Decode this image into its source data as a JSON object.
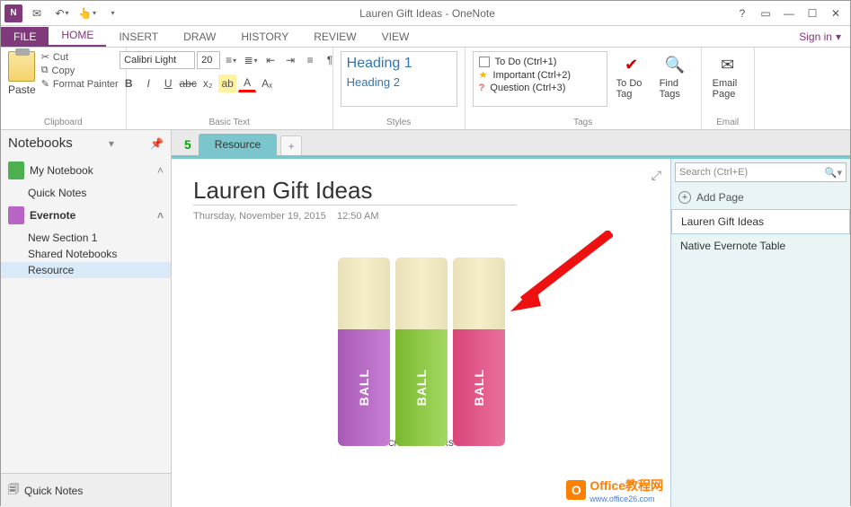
{
  "window": {
    "title": "Lauren Gift Ideas - OneNote"
  },
  "tabs": {
    "file": "FILE",
    "home": "HOME",
    "insert": "INSERT",
    "draw": "DRAW",
    "history": "HISTORY",
    "review": "REVIEW",
    "view": "VIEW",
    "signin": "Sign in"
  },
  "clipboard": {
    "label": "Clipboard",
    "paste": "Paste",
    "cut": "Cut",
    "copy": "Copy",
    "painter": "Format Painter"
  },
  "font": {
    "label": "Basic Text",
    "name": "Calibri Light",
    "size": "20"
  },
  "styles": {
    "label": "Styles",
    "h1": "Heading 1",
    "h2": "Heading 2"
  },
  "tags": {
    "label": "Tags",
    "todo": "To Do (Ctrl+1)",
    "important": "Important (Ctrl+2)",
    "question": "Question (Ctrl+3)",
    "todotag": "To Do Tag",
    "findtags": "Find Tags"
  },
  "email": {
    "label": "Email",
    "button": "Email Page"
  },
  "sidebar": {
    "title": "Notebooks",
    "notebooks": [
      {
        "name": "My Notebook",
        "color": "green"
      },
      {
        "name": "Evernote",
        "color": "purple"
      }
    ],
    "sections_nb1": [
      "Quick Notes"
    ],
    "sections_nb2": [
      "New Section 1",
      "Shared Notebooks",
      "Resource"
    ],
    "quicknotes": "Quick Notes"
  },
  "section": {
    "active": "Resource",
    "page_num": "5"
  },
  "page": {
    "title": "Lauren Gift Ideas",
    "date": "Thursday, November 19, 2015",
    "time": "12:50 AM"
  },
  "search": {
    "placeholder": "Search (Ctrl+E)"
  },
  "pages": {
    "add": "Add Page",
    "list": [
      "Lauren Gift Ideas",
      "Native Evernote Table"
    ]
  },
  "product": {
    "brand": "CRAZY RUMORS",
    "label": "BALL"
  },
  "watermark": {
    "title": "Office教程网",
    "url": "www.office26.com"
  }
}
